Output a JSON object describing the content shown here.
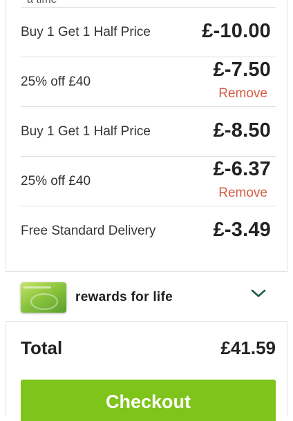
{
  "cutoff_text": "a time",
  "discounts": [
    {
      "label": "Buy 1 Get 1 Half Price",
      "amount": "£-10.00",
      "remove": ""
    },
    {
      "label": "25% off £40",
      "amount": "£-7.50",
      "remove": "Remove"
    },
    {
      "label": "Buy 1 Get 1 Half Price",
      "amount": "£-8.50",
      "remove": ""
    },
    {
      "label": "25% off £40",
      "amount": "£-6.37",
      "remove": "Remove"
    },
    {
      "label": "Free Standard Delivery",
      "amount": "£-3.49",
      "remove": ""
    }
  ],
  "rewards": {
    "title": "rewards for life",
    "icon": "chevron-down-icon"
  },
  "total": {
    "label": "Total",
    "value": "£41.59"
  },
  "checkout": {
    "label": "Checkout",
    "color": "#7fc41a"
  },
  "colors": {
    "remove": "#d35c42",
    "chevron": "#1f5a4a"
  }
}
